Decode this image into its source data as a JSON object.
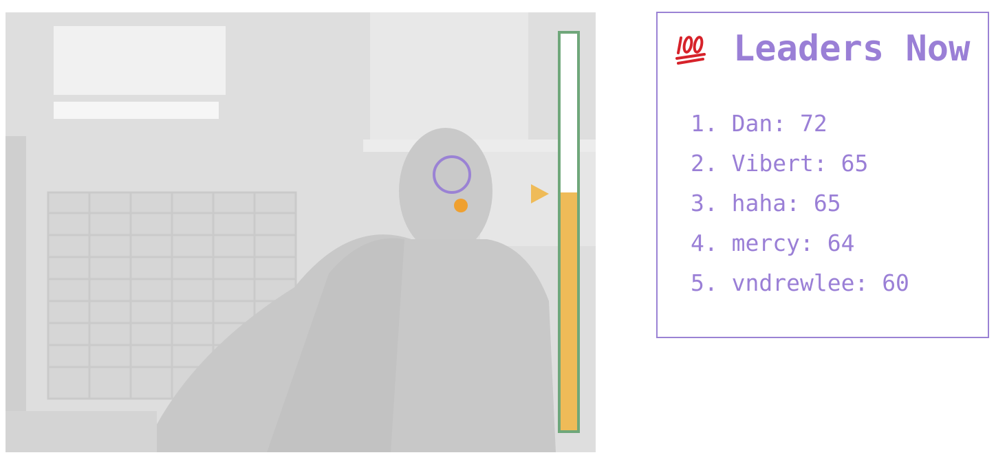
{
  "webcam": {
    "meter_level": 0.6,
    "colors": {
      "ring": "#9a82d4",
      "dot": "#efa030",
      "meter_border": "#6fa77a",
      "meter_fill": "#efbb58",
      "pointer": "#efbb58"
    }
  },
  "leaderboard": {
    "icon": "hundred-points-icon",
    "title": "Leaders Now",
    "entries": [
      {
        "rank": "1.",
        "name": "Dan",
        "score": "72"
      },
      {
        "rank": "2.",
        "name": "Vibert",
        "score": "65"
      },
      {
        "rank": "3.",
        "name": "haha",
        "score": "65"
      },
      {
        "rank": "4.",
        "name": "mercy",
        "score": "64"
      },
      {
        "rank": "5.",
        "name": "vndrewlee",
        "score": "60"
      }
    ],
    "accent_color": "#9a7fd6"
  }
}
